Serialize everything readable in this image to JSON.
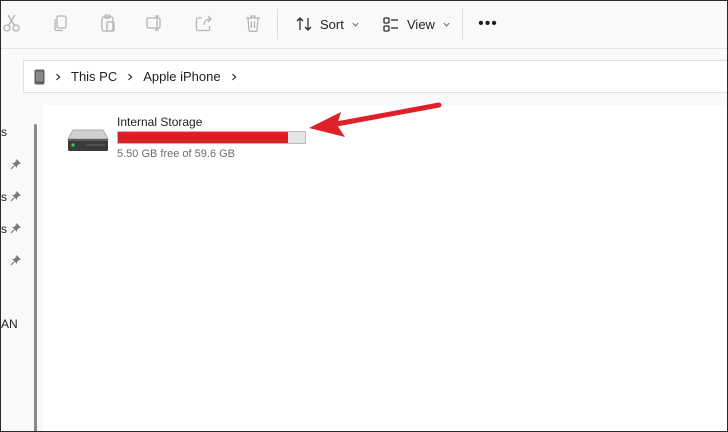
{
  "toolbar": {
    "sort_label": "Sort",
    "view_label": "View",
    "more_label": "•••",
    "icons": [
      "cut-icon",
      "copy-icon",
      "paste-icon",
      "rename-icon",
      "share-icon",
      "delete-icon",
      "sort-icon",
      "view-icon",
      "more-icon"
    ]
  },
  "address_bar": {
    "breadcrumbs": [
      "This PC",
      "Apple iPhone"
    ]
  },
  "nav_pane": {
    "fragments": [
      "s",
      "s",
      "s",
      "AN"
    ]
  },
  "drive": {
    "name": "Internal Storage",
    "free_text": "5.50 GB free of 59.6 GB",
    "used_fraction": 0.908,
    "bar_color": "#da2027"
  },
  "annotation": {
    "arrow_color": "#e02029"
  }
}
